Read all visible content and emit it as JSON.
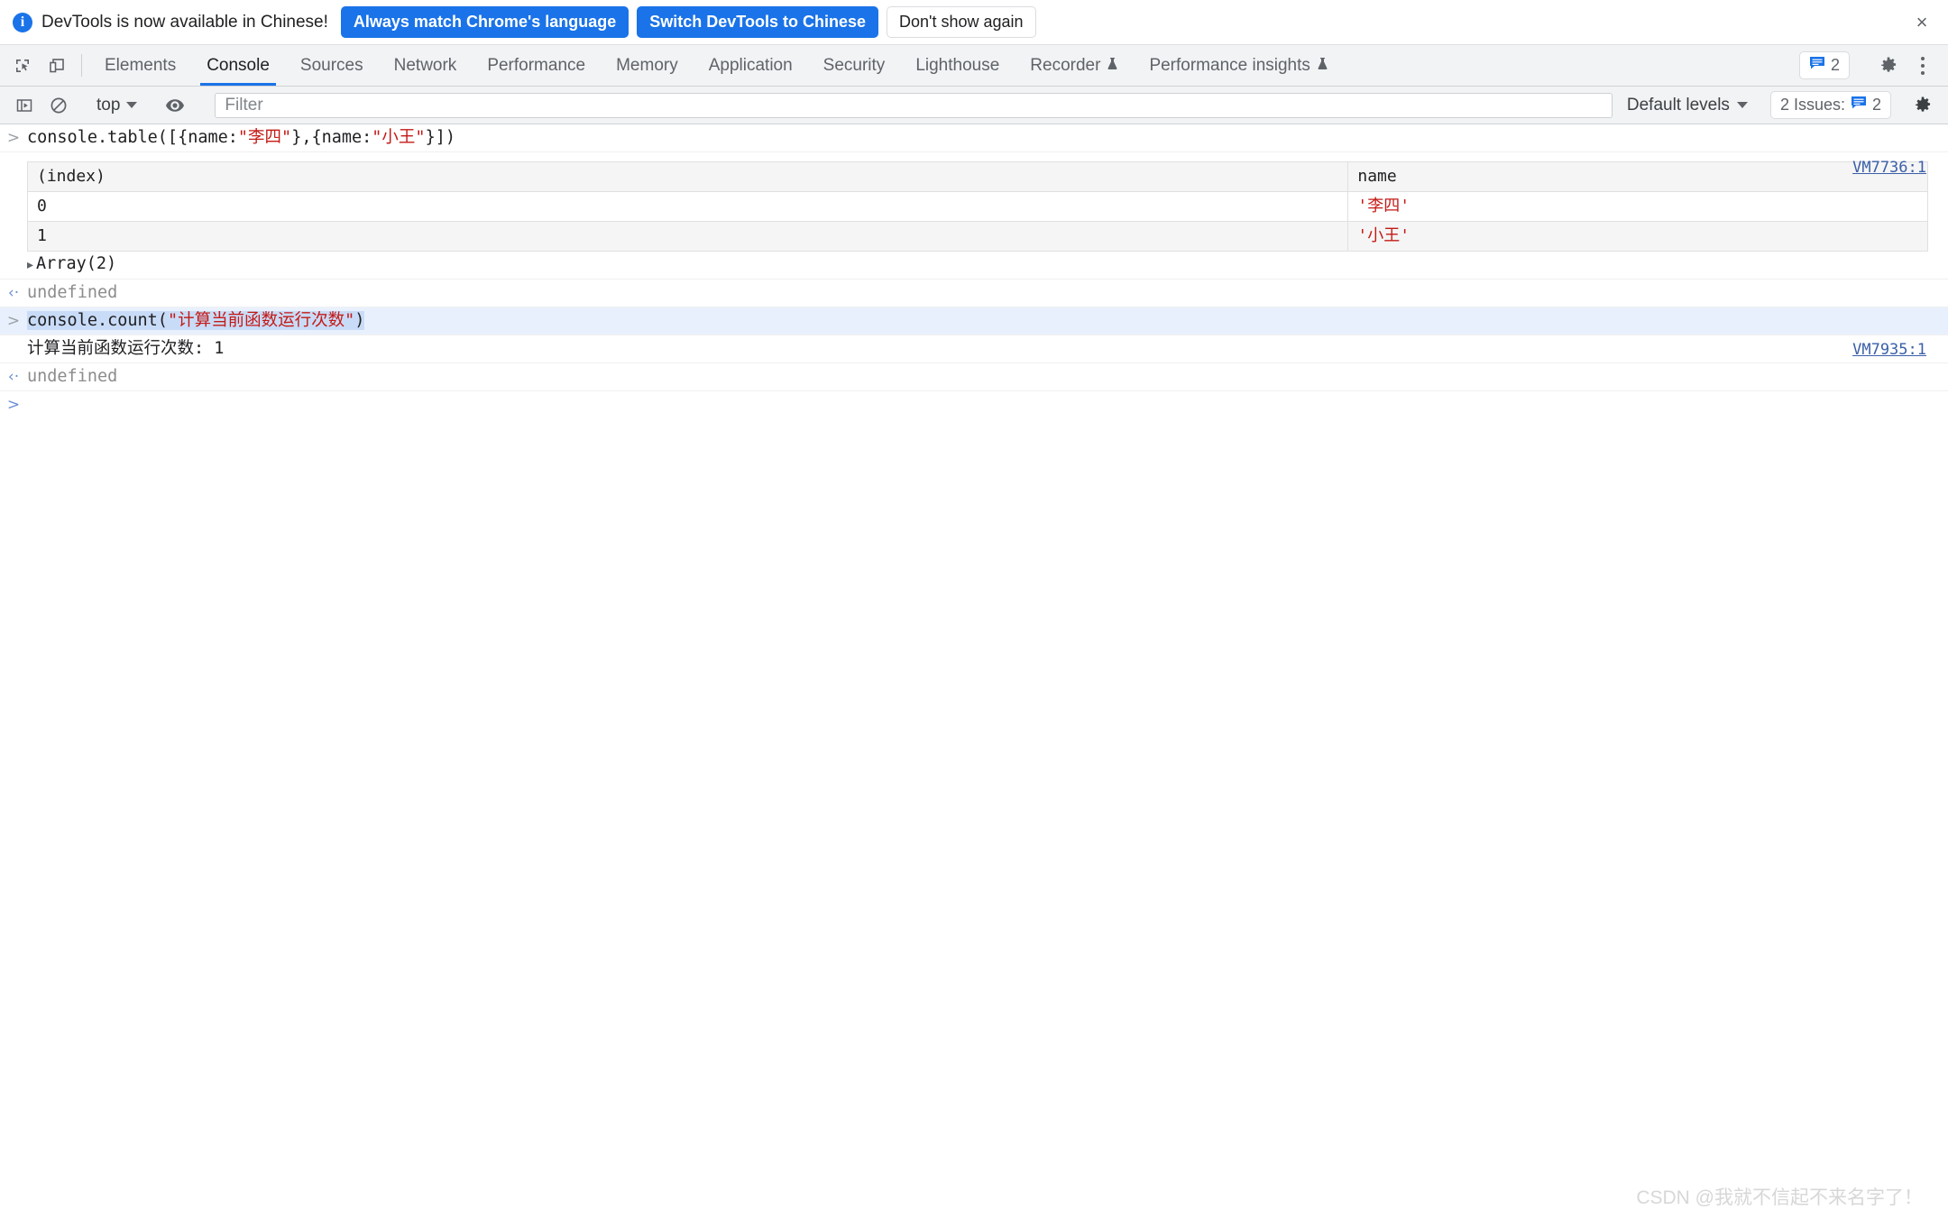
{
  "banner": {
    "info_icon": "info-icon",
    "message": "DevTools is now available in Chinese!",
    "primary_button": "Always match Chrome's language",
    "secondary_button": "Switch DevTools to Chinese",
    "tertiary_button": "Don't show again",
    "close_icon": "×",
    "accent_color": "#1a73e8"
  },
  "tabstrip": {
    "inspect_icon": "inspect-element-icon",
    "device_icon": "device-toolbar-icon",
    "tabs": [
      {
        "label": "Elements",
        "active": false,
        "experimental": false
      },
      {
        "label": "Console",
        "active": true,
        "experimental": false
      },
      {
        "label": "Sources",
        "active": false,
        "experimental": false
      },
      {
        "label": "Network",
        "active": false,
        "experimental": false
      },
      {
        "label": "Performance",
        "active": false,
        "experimental": false
      },
      {
        "label": "Memory",
        "active": false,
        "experimental": false
      },
      {
        "label": "Application",
        "active": false,
        "experimental": false
      },
      {
        "label": "Security",
        "active": false,
        "experimental": false
      },
      {
        "label": "Lighthouse",
        "active": false,
        "experimental": false
      },
      {
        "label": "Recorder",
        "active": false,
        "experimental": true
      },
      {
        "label": "Performance insights",
        "active": false,
        "experimental": true
      }
    ],
    "issues_count": "2",
    "issues_icon": "issues-message-icon",
    "settings_icon": "gear-icon",
    "more_icon": "kebab-menu-icon",
    "active_tab_underline_color": "#1a73e8"
  },
  "filterbar": {
    "sidebar_toggle_icon": "console-sidebar-icon",
    "clear_console_icon": "clear-console-icon",
    "context": "top",
    "eye_icon": "live-expression-icon",
    "filter_placeholder": "Filter",
    "filter_value": "",
    "levels": "Default levels",
    "issues_label": "2 Issues:",
    "issues_count": "2",
    "settings_icon": "gear-icon"
  },
  "console": {
    "entries": [
      {
        "kind": "command",
        "gutter": ">",
        "code_prefix": "console.table([{name:",
        "str1": "\"李四\"",
        "code_mid": "},{name:",
        "str2": "\"小王\"",
        "code_suffix": "}])",
        "selected": false
      },
      {
        "kind": "table",
        "vm_link": "VM7736:1",
        "columns": [
          "(index)",
          "name"
        ],
        "rows": [
          {
            "index": "0",
            "name": "'李四'"
          },
          {
            "index": "1",
            "name": "'小王'"
          }
        ],
        "footer": "Array(2)",
        "footer_disclosure": "▸"
      },
      {
        "kind": "result",
        "gutter": "‹·",
        "value": "undefined"
      },
      {
        "kind": "command",
        "gutter": ">",
        "code_prefix": "console.count(",
        "str1": "\"计算当前函数运行次数\"",
        "code_suffix": ")",
        "selected": true
      },
      {
        "kind": "log",
        "text": "计算当前函数运行次数: 1",
        "vm_link": "VM7935:1"
      },
      {
        "kind": "result",
        "gutter": "‹·",
        "value": "undefined"
      },
      {
        "kind": "prompt",
        "gutter": ">",
        "value": ""
      }
    ]
  },
  "watermark": {
    "text": "CSDN @我就不信起不来名字了！"
  }
}
